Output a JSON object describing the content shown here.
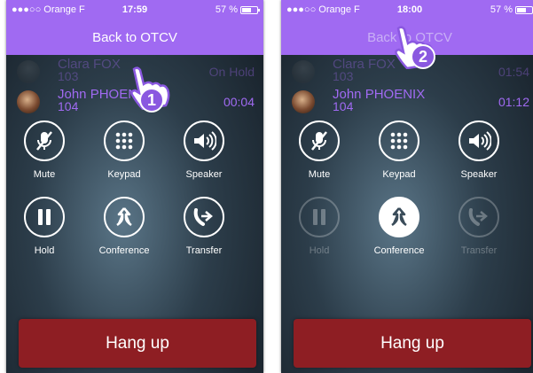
{
  "screens": [
    {
      "status": {
        "carrier": "●●●○○ Orange F",
        "time": "17:59",
        "battery": "57 %"
      },
      "back_label": "Back to OTCV",
      "calls": [
        {
          "name": "Clara FOX",
          "ext": "103",
          "status": "On Hold"
        },
        {
          "name": "John PHOENIX",
          "ext": "104",
          "status": "00:04"
        }
      ],
      "buttons": {
        "mute": "Mute",
        "keypad": "Keypad",
        "speaker": "Speaker",
        "hold": "Hold",
        "conference": "Conference",
        "transfer": "Transfer"
      },
      "hangup": "Hang up",
      "step": "1"
    },
    {
      "status": {
        "carrier": "●●●○○ Orange F",
        "time": "18:00",
        "battery": "57 %"
      },
      "back_label": "Back to OTCV",
      "calls": [
        {
          "name": "Clara FOX",
          "ext": "103",
          "status": "01:54"
        },
        {
          "name": "John PHOENIX",
          "ext": "104",
          "status": "01:12"
        }
      ],
      "buttons": {
        "mute": "Mute",
        "keypad": "Keypad",
        "speaker": "Speaker",
        "hold": "Hold",
        "conference": "Conference",
        "transfer": "Transfer"
      },
      "hangup": "Hang up",
      "step": "2"
    }
  ],
  "icons": {
    "mute": "mic-muted-icon",
    "keypad": "keypad-icon",
    "speaker": "speaker-icon",
    "hold": "pause-icon",
    "conference": "merge-icon",
    "transfer": "transfer-icon",
    "cursor": "pointing-hand-icon"
  },
  "colors": {
    "accent": "#a06af2",
    "hangup": "#8e1e23"
  }
}
